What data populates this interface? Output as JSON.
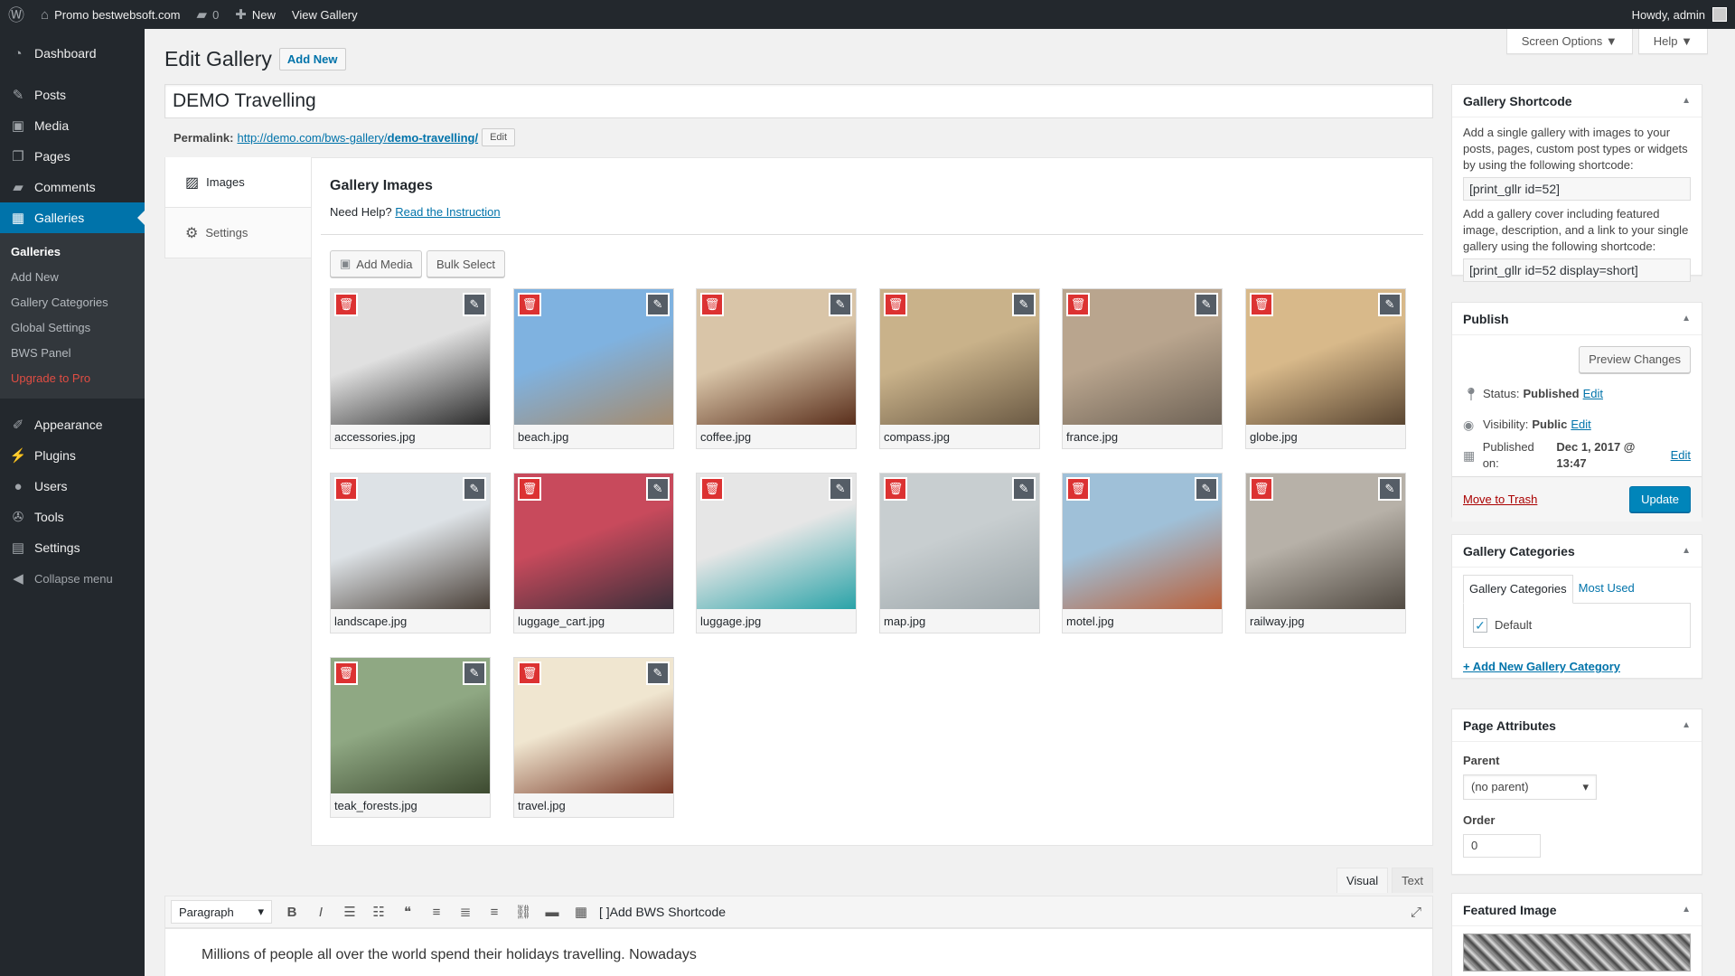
{
  "adminbar": {
    "site_name": "Promo bestwebsoft.com",
    "comments_count": "0",
    "new_label": "New",
    "view_gallery": "View Gallery",
    "howdy": "Howdy, admin"
  },
  "menu": {
    "dashboard": "Dashboard",
    "posts": "Posts",
    "media": "Media",
    "pages": "Pages",
    "comments": "Comments",
    "galleries": "Galleries",
    "sub": [
      "Galleries",
      "Add New",
      "Gallery Categories",
      "Global Settings",
      "BWS Panel",
      "Upgrade to Pro"
    ],
    "appearance": "Appearance",
    "plugins": "Plugins",
    "users": "Users",
    "tools": "Tools",
    "settings": "Settings",
    "collapse": "Collapse menu"
  },
  "header": {
    "title": "Edit Gallery",
    "add_new": "Add New",
    "screen_options": "Screen Options ▼",
    "help": "Help ▼"
  },
  "post": {
    "title": "DEMO Travelling",
    "permalink_label": "Permalink:",
    "permalink_base": "http://demo.com/bws-gallery/",
    "permalink_slug": "demo-travelling/",
    "edit": "Edit"
  },
  "gallery": {
    "tab_images": "Images",
    "tab_settings": "Settings",
    "heading": "Gallery Images",
    "help_text": "Need Help?",
    "help_link": "Read the Instruction",
    "add_media": "Add Media",
    "bulk_select": "Bulk Select",
    "images": [
      {
        "name": "accessories.jpg",
        "colors": [
          "#e0e0e0",
          "#2b2b2b"
        ]
      },
      {
        "name": "beach.jpg",
        "colors": [
          "#7fb2e0",
          "#a58b6e"
        ]
      },
      {
        "name": "coffee.jpg",
        "colors": [
          "#d9c5a8",
          "#5a2f1c"
        ]
      },
      {
        "name": "compass.jpg",
        "colors": [
          "#c9b28a",
          "#6b5a44"
        ]
      },
      {
        "name": "france.jpg",
        "colors": [
          "#b9a58e",
          "#6f6356"
        ]
      },
      {
        "name": "globe.jpg",
        "colors": [
          "#d8b98a",
          "#5a4632"
        ]
      },
      {
        "name": "landscape.jpg",
        "colors": [
          "#dde2e6",
          "#4a4038"
        ]
      },
      {
        "name": "luggage_cart.jpg",
        "colors": [
          "#c84a5c",
          "#3b2f3a"
        ]
      },
      {
        "name": "luggage.jpg",
        "colors": [
          "#e6e6e6",
          "#2aa3a8"
        ]
      },
      {
        "name": "map.jpg",
        "colors": [
          "#c8ced0",
          "#9aa4a8"
        ]
      },
      {
        "name": "motel.jpg",
        "colors": [
          "#9fc0d8",
          "#b9603a"
        ]
      },
      {
        "name": "railway.jpg",
        "colors": [
          "#b7b1a8",
          "#514a42"
        ]
      },
      {
        "name": "teak_forests.jpg",
        "colors": [
          "#8fa883",
          "#3d4a30"
        ]
      },
      {
        "name": "travel.jpg",
        "colors": [
          "#f0e6d0",
          "#7a3a28"
        ]
      }
    ]
  },
  "editor": {
    "tab_visual": "Visual",
    "tab_text": "Text",
    "format": "Paragraph",
    "shortcode_btn": "Add BWS Shortcode",
    "body": "Millions of people all over the world spend their holidays travelling. Nowadays"
  },
  "sidebar": {
    "shortcode": {
      "title": "Gallery Shortcode",
      "text1": "Add a single gallery with images to your posts, pages, custom post types or widgets by using the following shortcode:",
      "code1": "[print_gllr id=52]",
      "text2": "Add a gallery cover including featured image, description, and a link to your single gallery using the following shortcode:",
      "code2": "[print_gllr id=52 display=short]"
    },
    "publish": {
      "title": "Publish",
      "preview": "Preview Changes",
      "status_label": "Status:",
      "status_value": "Published",
      "visibility_label": "Visibility:",
      "visibility_value": "Public",
      "published_label": "Published on:",
      "published_value": "Dec 1, 2017 @ 13:47",
      "edit": "Edit",
      "trash": "Move to Trash",
      "update": "Update"
    },
    "categories": {
      "title": "Gallery Categories",
      "tab_all": "Gallery Categories",
      "tab_used": "Most Used",
      "default": "Default",
      "add_new": "+ Add New Gallery Category"
    },
    "attributes": {
      "title": "Page Attributes",
      "parent_label": "Parent",
      "parent_value": "(no parent)",
      "order_label": "Order",
      "order_value": "0"
    },
    "featured": {
      "title": "Featured Image"
    }
  }
}
